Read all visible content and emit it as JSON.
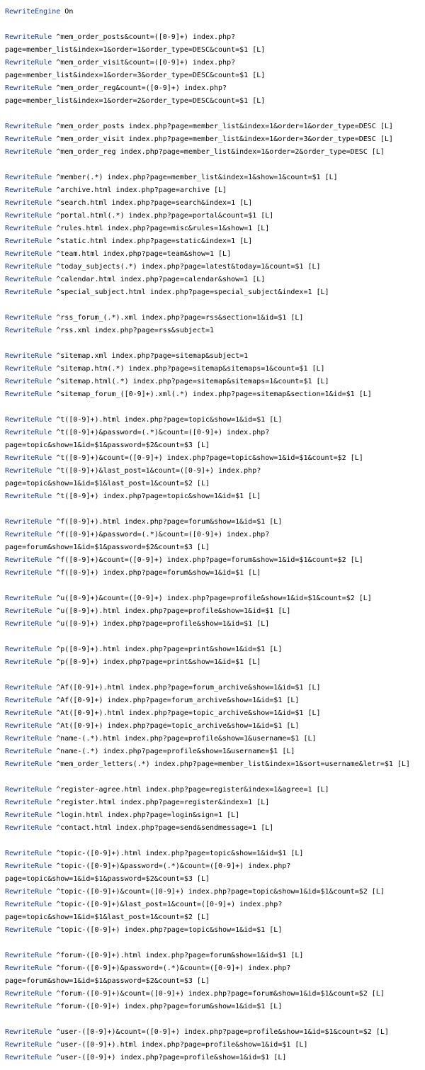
{
  "lines": [
    {
      "kw": "RewriteEngine",
      "rest": " On"
    },
    {
      "kw": "",
      "rest": ""
    },
    {
      "kw": "RewriteRule",
      "rest": " ^mem_order_posts&count=([0-9]+) index.php?"
    },
    {
      "kw": "",
      "rest": "page=member_list&index=1&order=1&order_type=DESC&count=$1 [L]"
    },
    {
      "kw": "RewriteRule",
      "rest": " ^mem_order_visit&count=([0-9]+) index.php?"
    },
    {
      "kw": "",
      "rest": "page=member_list&index=1&order=3&order_type=DESC&count=$1 [L]"
    },
    {
      "kw": "RewriteRule",
      "rest": " ^mem_order_reg&count=([0-9]+) index.php?"
    },
    {
      "kw": "",
      "rest": "page=member_list&index=1&order=2&order_type=DESC&count=$1 [L]"
    },
    {
      "kw": "",
      "rest": ""
    },
    {
      "kw": "RewriteRule",
      "rest": " ^mem_order_posts index.php?page=member_list&index=1&order=1&order_type=DESC [L]"
    },
    {
      "kw": "RewriteRule",
      "rest": " ^mem_order_visit index.php?page=member_list&index=1&order=3&order_type=DESC [L]"
    },
    {
      "kw": "RewriteRule",
      "rest": " ^mem_order_reg index.php?page=member_list&index=1&order=2&order_type=DESC [L]"
    },
    {
      "kw": "",
      "rest": ""
    },
    {
      "kw": "RewriteRule",
      "rest": " ^member(.*) index.php?page=member_list&index=1&show=1&count=$1 [L]"
    },
    {
      "kw": "RewriteRule",
      "rest": " ^archive.html index.php?page=archive [L]"
    },
    {
      "kw": "RewriteRule",
      "rest": " ^search.html index.php?page=search&index=1 [L]"
    },
    {
      "kw": "RewriteRule",
      "rest": " ^portal.html(.*) index.php?page=portal&count=$1 [L]"
    },
    {
      "kw": "RewriteRule",
      "rest": " ^rules.html index.php?page=misc&rules=1&show=1 [L]"
    },
    {
      "kw": "RewriteRule",
      "rest": " ^static.html index.php?page=static&index=1 [L]"
    },
    {
      "kw": "RewriteRule",
      "rest": " ^team.html index.php?page=team&show=1 [L]"
    },
    {
      "kw": "RewriteRule",
      "rest": " ^today_subjects(.*) index.php?page=latest&today=1&count=$1 [L]"
    },
    {
      "kw": "RewriteRule",
      "rest": " ^calendar.html index.php?page=calendar&show=1 [L]"
    },
    {
      "kw": "RewriteRule",
      "rest": " ^special_subject.html index.php?page=special_subject&index=1 [L]"
    },
    {
      "kw": "",
      "rest": ""
    },
    {
      "kw": "RewriteRule",
      "rest": " ^rss_forum_(.*).xml index.php?page=rss&section=1&id=$1 [L]"
    },
    {
      "kw": "RewriteRule",
      "rest": " ^rss.xml index.php?page=rss&subject=1"
    },
    {
      "kw": "",
      "rest": ""
    },
    {
      "kw": "RewriteRule",
      "rest": " ^sitemap.xml index.php?page=sitemap&subject=1"
    },
    {
      "kw": "RewriteRule",
      "rest": " ^sitemap.htm(.*) index.php?page=sitemap&sitemaps=1&count=$1 [L]"
    },
    {
      "kw": "RewriteRule",
      "rest": " ^sitemap.html(.*) index.php?page=sitemap&sitemaps=1&count=$1 [L]"
    },
    {
      "kw": "RewriteRule",
      "rest": " ^sitemap_forum_([0-9]+).xml(.*) index.php?page=sitemap&section=1&id=$1 [L]"
    },
    {
      "kw": "",
      "rest": ""
    },
    {
      "kw": "RewriteRule",
      "rest": " ^t([0-9]+).html index.php?page=topic&show=1&id=$1 [L]"
    },
    {
      "kw": "RewriteRule",
      "rest": " ^t([0-9]+)&password=(.*)&count=([0-9]+) index.php?"
    },
    {
      "kw": "",
      "rest": "page=topic&show=1&id=$1&password=$2&count=$3 [L]"
    },
    {
      "kw": "RewriteRule",
      "rest": " ^t([0-9]+)&count=([0-9]+) index.php?page=topic&show=1&id=$1&count=$2 [L]"
    },
    {
      "kw": "RewriteRule",
      "rest": " ^t([0-9]+)&last_post=1&count=([0-9]+) index.php?"
    },
    {
      "kw": "",
      "rest": "page=topic&show=1&id=$1&last_post=1&count=$2 [L]"
    },
    {
      "kw": "RewriteRule",
      "rest": " ^t([0-9]+) index.php?page=topic&show=1&id=$1 [L]"
    },
    {
      "kw": "",
      "rest": ""
    },
    {
      "kw": "RewriteRule",
      "rest": " ^f([0-9]+).html index.php?page=forum&show=1&id=$1 [L]"
    },
    {
      "kw": "RewriteRule",
      "rest": " ^f([0-9]+)&password=(.*)&count=([0-9]+) index.php?"
    },
    {
      "kw": "",
      "rest": "page=forum&show=1&id=$1&password=$2&count=$3 [L]"
    },
    {
      "kw": "RewriteRule",
      "rest": " ^f([0-9]+)&count=([0-9]+) index.php?page=forum&show=1&id=$1&count=$2 [L]"
    },
    {
      "kw": "RewriteRule",
      "rest": " ^f([0-9]+) index.php?page=forum&show=1&id=$1 [L]"
    },
    {
      "kw": "",
      "rest": ""
    },
    {
      "kw": "RewriteRule",
      "rest": " ^u([0-9]+)&count=([0-9]+) index.php?page=profile&show=1&id=$1&count=$2 [L]"
    },
    {
      "kw": "RewriteRule",
      "rest": " ^u([0-9]+).html index.php?page=profile&show=1&id=$1 [L]"
    },
    {
      "kw": "RewriteRule",
      "rest": " ^u([0-9]+) index.php?page=profile&show=1&id=$1 [L]"
    },
    {
      "kw": "",
      "rest": ""
    },
    {
      "kw": "RewriteRule",
      "rest": " ^p([0-9]+).html index.php?page=print&show=1&id=$1 [L]"
    },
    {
      "kw": "RewriteRule",
      "rest": " ^p([0-9]+) index.php?page=print&show=1&id=$1 [L]"
    },
    {
      "kw": "",
      "rest": ""
    },
    {
      "kw": "RewriteRule",
      "rest": " ^Af([0-9]+).html index.php?page=forum_archive&show=1&id=$1 [L]"
    },
    {
      "kw": "RewriteRule",
      "rest": " ^Af([0-9]+) index.php?page=forum_archive&show=1&id=$1 [L]"
    },
    {
      "kw": "RewriteRule",
      "rest": " ^At([0-9]+).html index.php?page=topic_archive&show=1&id=$1 [L]"
    },
    {
      "kw": "RewriteRule",
      "rest": " ^At([0-9]+) index.php?page=topic_archive&show=1&id=$1 [L]"
    },
    {
      "kw": "RewriteRule",
      "rest": " ^name-(.*).html index.php?page=profile&show=1&username=$1 [L]"
    },
    {
      "kw": "RewriteRule",
      "rest": " ^name-(.*) index.php?page=profile&show=1&username=$1 [L]"
    },
    {
      "kw": "RewriteRule",
      "rest": " ^mem_order_letters(.*) index.php?page=member_list&index=1&sort=username&letr=$1 [L]"
    },
    {
      "kw": "",
      "rest": ""
    },
    {
      "kw": "RewriteRule",
      "rest": " ^register-agree.html index.php?page=register&index=1&agree=1 [L]"
    },
    {
      "kw": "RewriteRule",
      "rest": " ^register.html index.php?page=register&index=1 [L]"
    },
    {
      "kw": "RewriteRule",
      "rest": " ^login.html index.php?page=login&sign=1 [L]"
    },
    {
      "kw": "RewriteRule",
      "rest": " ^contact.html index.php?page=send&sendmessage=1 [L]"
    },
    {
      "kw": "",
      "rest": ""
    },
    {
      "kw": "RewriteRule",
      "rest": " ^topic-([0-9]+).html index.php?page=topic&show=1&id=$1 [L]"
    },
    {
      "kw": "RewriteRule",
      "rest": " ^topic-([0-9]+)&password=(.*)&count=([0-9]+) index.php?"
    },
    {
      "kw": "",
      "rest": "page=topic&show=1&id=$1&password=$2&count=$3 [L]"
    },
    {
      "kw": "RewriteRule",
      "rest": " ^topic-([0-9]+)&count=([0-9]+) index.php?page=topic&show=1&id=$1&count=$2 [L]"
    },
    {
      "kw": "RewriteRule",
      "rest": " ^topic-([0-9]+)&last_post=1&count=([0-9]+) index.php?"
    },
    {
      "kw": "",
      "rest": "page=topic&show=1&id=$1&last_post=1&count=$2 [L]"
    },
    {
      "kw": "RewriteRule",
      "rest": " ^topic-([0-9]+) index.php?page=topic&show=1&id=$1 [L]"
    },
    {
      "kw": "",
      "rest": ""
    },
    {
      "kw": "RewriteRule",
      "rest": " ^forum-([0-9]+).html index.php?page=forum&show=1&id=$1 [L]"
    },
    {
      "kw": "RewriteRule",
      "rest": " ^forum-([0-9]+)&password=(.*)&count=([0-9]+) index.php?"
    },
    {
      "kw": "",
      "rest": "page=forum&show=1&id=$1&password=$2&count=$3 [L]"
    },
    {
      "kw": "RewriteRule",
      "rest": " ^forum-([0-9]+)&count=([0-9]+) index.php?page=forum&show=1&id=$1&count=$2 [L]"
    },
    {
      "kw": "RewriteRule",
      "rest": " ^forum-([0-9]+) index.php?page=forum&show=1&id=$1 [L]"
    },
    {
      "kw": "",
      "rest": ""
    },
    {
      "kw": "RewriteRule",
      "rest": " ^user-([0-9]+)&count=([0-9]+) index.php?page=profile&show=1&id=$1&count=$2 [L]"
    },
    {
      "kw": "RewriteRule",
      "rest": " ^user-([0-9]+).html index.php?page=profile&show=1&id=$1 [L]"
    },
    {
      "kw": "RewriteRule",
      "rest": " ^user-([0-9]+) index.php?page=profile&show=1&id=$1 [L]"
    }
  ]
}
